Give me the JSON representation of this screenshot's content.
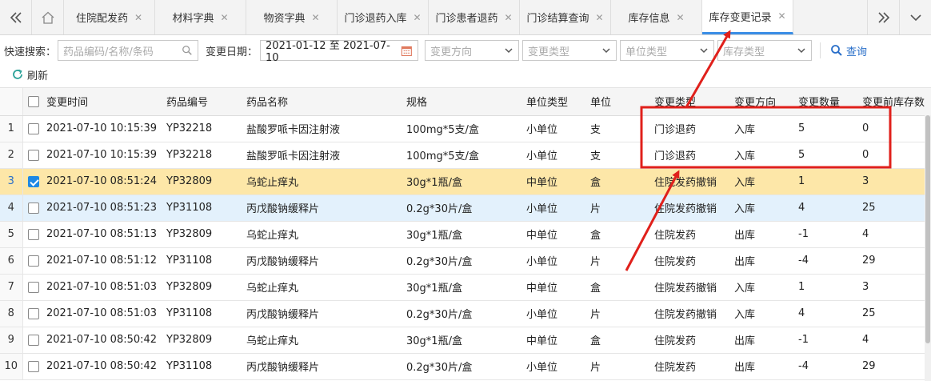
{
  "tabs": [
    {
      "label": "住院配发药"
    },
    {
      "label": "材料字典"
    },
    {
      "label": "物资字典"
    },
    {
      "label": "门诊退药入库"
    },
    {
      "label": "门诊患者退药"
    },
    {
      "label": "门诊结算查询"
    },
    {
      "label": "库存信息"
    },
    {
      "label": "库存变更记录"
    }
  ],
  "toolbar": {
    "quick_search_label": "快速搜索：",
    "quick_search_placeholder": "药品编码/名称/条码",
    "date_label": "变更日期：",
    "date_value": "2021-01-12 至 2021-07-10",
    "direction_placeholder": "变更方向",
    "type_placeholder": "变更类型",
    "unit_type_placeholder": "单位类型",
    "stock_type_placeholder": "库存类型",
    "query_label": "查询",
    "refresh_label": "刷新"
  },
  "table": {
    "headers": [
      "变更时间",
      "药品编号",
      "药品名称",
      "规格",
      "单位类型",
      "单位",
      "变更类型",
      "变更方向",
      "变更数量",
      "变更前库存数"
    ],
    "rows": [
      {
        "n": "1",
        "checked": false,
        "time": "2021-07-10 10:15:39",
        "code": "YP32218",
        "name": "盐酸罗哌卡因注射液",
        "spec": "100mg*5支/盒",
        "utype": "小单位",
        "unit": "支",
        "ctype": "门诊退药",
        "dir": "入库",
        "qty": "5",
        "before": "0"
      },
      {
        "n": "2",
        "checked": false,
        "time": "2021-07-10 10:15:39",
        "code": "YP32218",
        "name": "盐酸罗哌卡因注射液",
        "spec": "100mg*5支/盒",
        "utype": "小单位",
        "unit": "支",
        "ctype": "门诊退药",
        "dir": "入库",
        "qty": "5",
        "before": "0"
      },
      {
        "n": "3",
        "checked": true,
        "time": "2021-07-10 08:51:24",
        "code": "YP32809",
        "name": "乌蛇止痒丸",
        "spec": "30g*1瓶/盒",
        "utype": "中单位",
        "unit": "盒",
        "ctype": "住院发药撤销",
        "dir": "入库",
        "qty": "1",
        "before": "3"
      },
      {
        "n": "4",
        "checked": false,
        "time": "2021-07-10 08:51:23",
        "code": "YP31108",
        "name": "丙戊酸钠缓释片",
        "spec": "0.2g*30片/盒",
        "utype": "小单位",
        "unit": "片",
        "ctype": "住院发药撤销",
        "dir": "入库",
        "qty": "4",
        "before": "25"
      },
      {
        "n": "5",
        "checked": false,
        "time": "2021-07-10 08:51:13",
        "code": "YP32809",
        "name": "乌蛇止痒丸",
        "spec": "30g*1瓶/盒",
        "utype": "中单位",
        "unit": "盒",
        "ctype": "住院发药",
        "dir": "出库",
        "qty": "-1",
        "before": "4"
      },
      {
        "n": "6",
        "checked": false,
        "time": "2021-07-10 08:51:12",
        "code": "YP31108",
        "name": "丙戊酸钠缓释片",
        "spec": "0.2g*30片/盒",
        "utype": "小单位",
        "unit": "片",
        "ctype": "住院发药",
        "dir": "出库",
        "qty": "-4",
        "before": "29"
      },
      {
        "n": "7",
        "checked": false,
        "time": "2021-07-10 08:51:03",
        "code": "YP32809",
        "name": "乌蛇止痒丸",
        "spec": "30g*1瓶/盒",
        "utype": "中单位",
        "unit": "盒",
        "ctype": "住院发药撤销",
        "dir": "入库",
        "qty": "1",
        "before": "3"
      },
      {
        "n": "8",
        "checked": false,
        "time": "2021-07-10 08:51:03",
        "code": "YP31108",
        "name": "丙戊酸钠缓释片",
        "spec": "0.2g*30片/盒",
        "utype": "小单位",
        "unit": "片",
        "ctype": "住院发药撤销",
        "dir": "入库",
        "qty": "4",
        "before": "25"
      },
      {
        "n": "9",
        "checked": false,
        "time": "2021-07-10 08:50:42",
        "code": "YP32809",
        "name": "乌蛇止痒丸",
        "spec": "30g*1瓶/盒",
        "utype": "中单位",
        "unit": "盒",
        "ctype": "住院发药",
        "dir": "出库",
        "qty": "-1",
        "before": "4"
      },
      {
        "n": "10",
        "checked": false,
        "time": "2021-07-10 08:50:42",
        "code": "YP31108",
        "name": "丙戊酸钠缓释片",
        "spec": "0.2g*30片/盒",
        "utype": "小单位",
        "unit": "片",
        "ctype": "住院发药",
        "dir": "出库",
        "qty": "-4",
        "before": "29"
      }
    ]
  },
  "annotation_color": "#e0201b",
  "selected_row_color": "#fde7a8",
  "accent_color": "#3a8ee6"
}
